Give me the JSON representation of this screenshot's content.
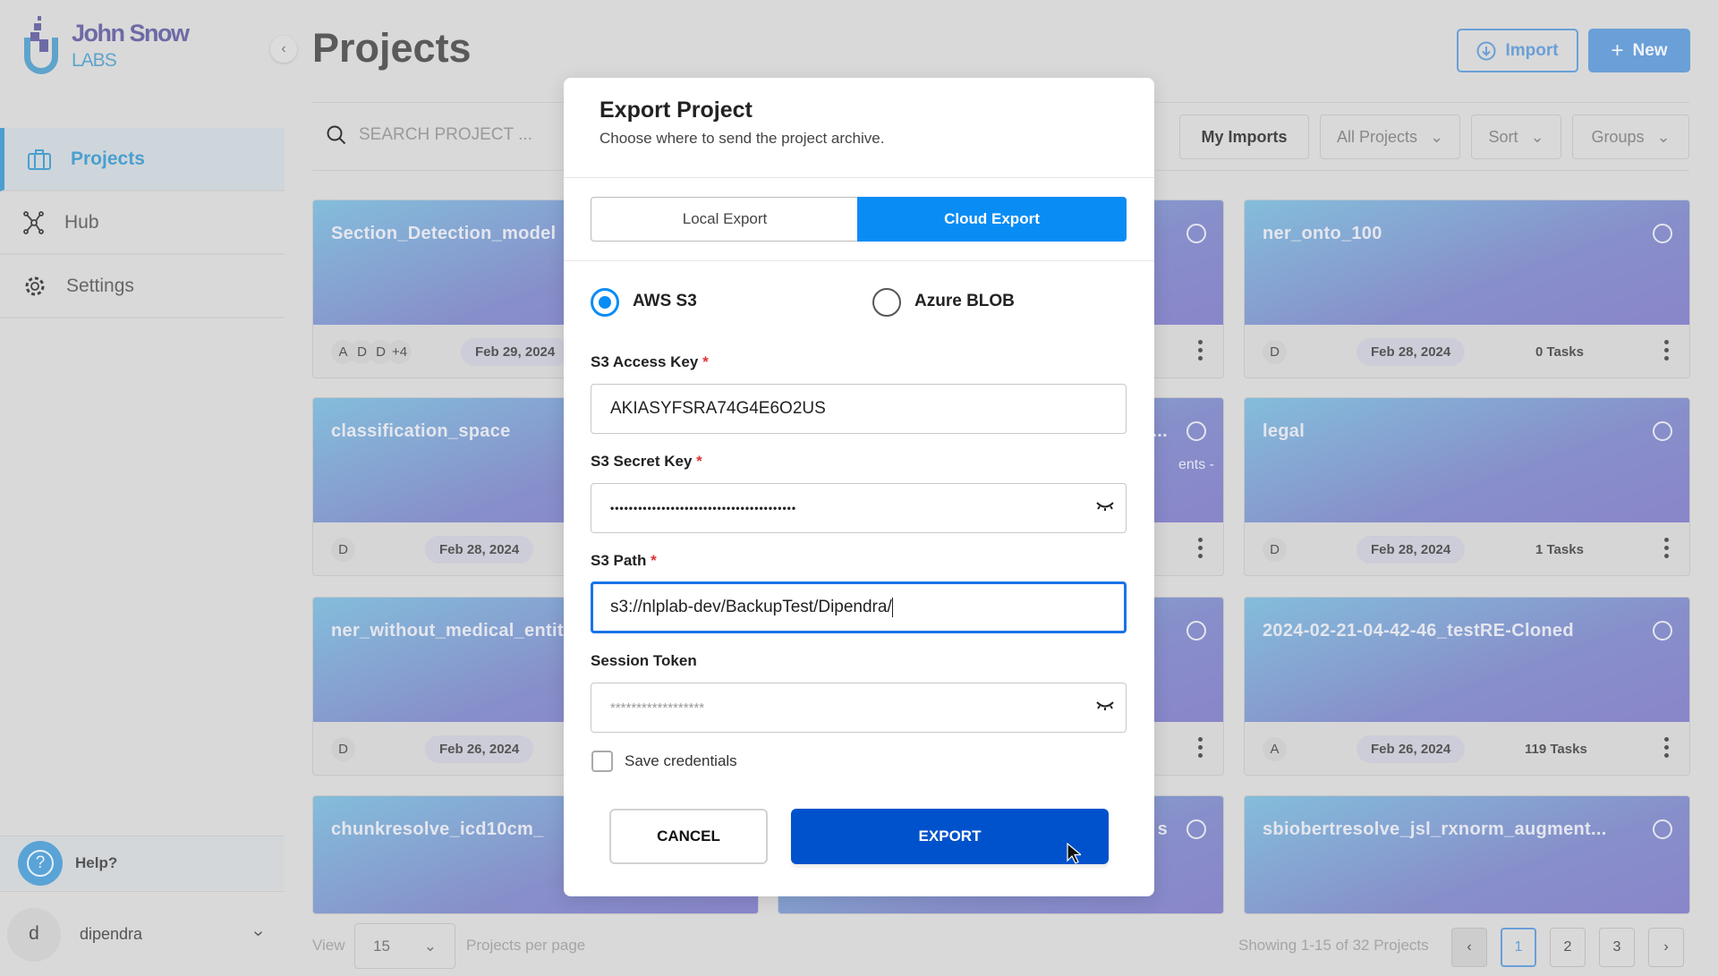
{
  "brand": {
    "name": "John Snow",
    "sub": "LABS"
  },
  "header": {
    "title": "Projects",
    "import_label": "Import",
    "new_label": "New"
  },
  "sidebar": {
    "items": [
      {
        "label": "Projects",
        "icon": "briefcase-icon"
      },
      {
        "label": "Hub",
        "icon": "hub-icon"
      },
      {
        "label": "Settings",
        "icon": "gear-icon"
      }
    ],
    "help_label": "Help?",
    "user": {
      "initial": "d",
      "name": "dipendra"
    }
  },
  "toolbar": {
    "search_placeholder": "SEARCH PROJECT ...",
    "my_imports": "My Imports",
    "all_projects": "All Projects",
    "sort": "Sort",
    "groups": "Groups"
  },
  "cards": [
    {
      "title": "Section_Detection_model",
      "avatars": [
        "A",
        "D",
        "D",
        "+4"
      ],
      "date": "Feb 29, 2024",
      "tasks": ""
    },
    {
      "title": "",
      "avatars": [],
      "date": "",
      "tasks": ""
    },
    {
      "title": "ner_onto_100",
      "avatars": [
        "D"
      ],
      "date": "Feb 28, 2024",
      "tasks": "0 Tasks"
    },
    {
      "title": "classification_space",
      "avatars": [
        "D"
      ],
      "date": "Feb 28, 2024",
      "tasks": ""
    },
    {
      "title": "n...",
      "desc": "ents -",
      "avatars": [],
      "date": "",
      "tasks": ""
    },
    {
      "title": "legal",
      "avatars": [
        "D"
      ],
      "date": "Feb 28, 2024",
      "tasks": "1 Tasks"
    },
    {
      "title": "ner_without_medical_entities",
      "avatars": [
        "D"
      ],
      "date": "Feb 26, 2024",
      "tasks": ""
    },
    {
      "title": "",
      "avatars": [],
      "date": "",
      "tasks": ""
    },
    {
      "title": "2024-02-21-04-42-46_testRE-Cloned",
      "avatars": [
        "A"
      ],
      "date": "Feb 26, 2024",
      "tasks": "119 Tasks"
    },
    {
      "title": "chunkresolve_icd10cm_",
      "avatars": [],
      "date": "",
      "tasks": ""
    },
    {
      "title": "s",
      "avatars": [],
      "date": "",
      "tasks": ""
    },
    {
      "title": "sbiobertresolve_jsl_rxnorm_augment...",
      "avatars": [],
      "date": "",
      "tasks": ""
    }
  ],
  "pagination": {
    "view_label": "View",
    "per_page": "15",
    "per_page_label": "Projects per page",
    "showing": "Showing 1-15 of 32 Projects",
    "pages": [
      "1",
      "2",
      "3"
    ],
    "current": "1",
    "prev": "‹",
    "next": "›"
  },
  "modal": {
    "title": "Export Project",
    "subtitle": "Choose where to send the project archive.",
    "tabs": [
      "Local Export",
      "Cloud Export"
    ],
    "active_tab": "Cloud Export",
    "providers": [
      "AWS S3",
      "Azure BLOB"
    ],
    "selected_provider": "AWS S3",
    "access_key_label": "S3 Access Key",
    "access_key": "AKIASYFSRA74G4E6O2US",
    "secret_key_label": "S3 Secret Key",
    "secret_key": "••••••••••••••••••••••••••••••••••••••••",
    "path_label": "S3 Path",
    "path": "s3://nlplab-dev/BackupTest/Dipendra/",
    "token_label": "Session Token",
    "token_placeholder": "******************",
    "required_mark": "*",
    "save_credentials": "Save credentials",
    "cancel": "CANCEL",
    "export": "EXPORT"
  },
  "colors": {
    "accent": "#0a8cf5",
    "export": "#0052cc",
    "brand": "#4a9fcf"
  }
}
